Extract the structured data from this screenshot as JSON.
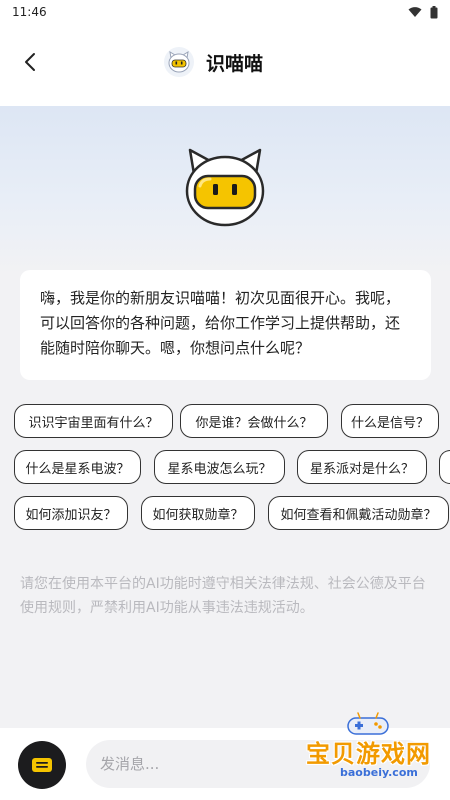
{
  "status_bar": {
    "time": "11:46"
  },
  "header": {
    "title": "识喵喵"
  },
  "greeting": {
    "text": "嗨，我是你的新朋友识喵喵！初次见面很开心。我呢，可以回答你的各种问题，给你工作学习上提供帮助，还能随时陪你聊天。嗯，你想问点什么呢？"
  },
  "suggestions": [
    "识识宇宙里面有什么？",
    "你是谁？会做什么？",
    "什么是信号？",
    "什么是星系电波？",
    "星系电波怎么玩？",
    "星系派对是什么？",
    "如何添加识友？",
    "如何获取勋章？",
    "如何查看和佩戴活动勋章？"
  ],
  "disclaimer": "请您在使用本平台的AI功能时遵守相关法律法规、社会公德及平台使用规则，严禁利用AI功能从事违法违规活动。",
  "input": {
    "placeholder": "发消息..."
  },
  "watermark": {
    "title": "宝贝游戏网",
    "url": "baobeiy.com"
  },
  "icons": {
    "back": "chevron-left-icon",
    "menu": "keyboard-icon",
    "wifi": "wifi-icon",
    "battery": "battery-icon"
  },
  "colors": {
    "mascot_eye_yellow": "#f5c400",
    "watermark_orange": "#f29a00",
    "watermark_blue": "#3a6fd8"
  }
}
